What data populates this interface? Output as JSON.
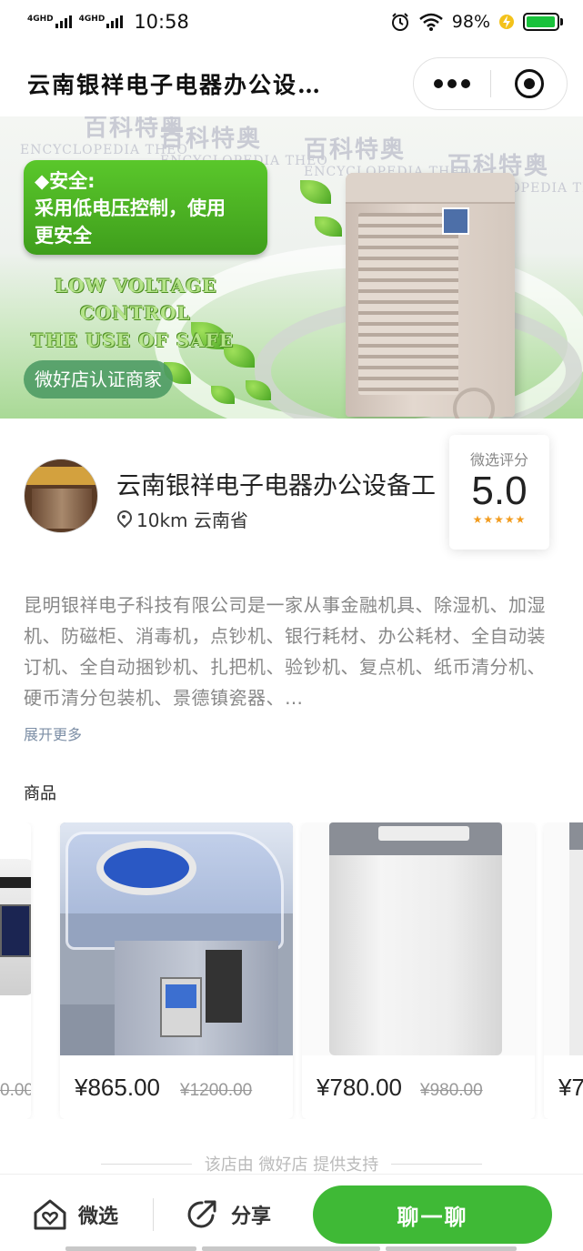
{
  "status_bar": {
    "network1": "4GHD",
    "network2": "4GHD",
    "time": "10:58",
    "battery": "98%"
  },
  "title_bar": {
    "title": "云南银祥电子电器办公设…"
  },
  "banner": {
    "watermark_cn": "百科特奥",
    "watermark_en": "ENCYCLOPEDIA THEO",
    "feature_title": "◆安全:",
    "feature_text1": "采用低电压控制，使用",
    "feature_text2": "更安全",
    "en_line1": "LOW VOLTAGE",
    "en_line2": "CONTROL",
    "en_line3": "THE USE OF SAFE",
    "verified_label": "微好店认证商家"
  },
  "shop": {
    "name": "云南银祥电子电器办公设备工",
    "distance_location": "10km 云南省",
    "score_label": "微选评分",
    "score_value": "5.0",
    "stars": "★★★★★",
    "description": "昆明银祥电子科技有限公司是一家从事金融机具、除湿机、加湿机、防磁柜、消毒机，点钞机、银行耗材、办公耗材、全自动装订机、全自动捆钞机、扎把机、验钞机、复点机、纸币清分机、硬币清分包装机、景德镇瓷器、…",
    "expand_label": "展开更多"
  },
  "products": {
    "section_title": "商品",
    "items": [
      {
        "price": "¥",
        "old_price": "0.00"
      },
      {
        "price": "¥865.00",
        "old_price": "¥1200.00"
      },
      {
        "price": "¥780.00",
        "old_price": "¥980.00"
      },
      {
        "price": "¥7"
      }
    ]
  },
  "footer": {
    "support_text": "该店由 微好店 提供支持"
  },
  "bottom_bar": {
    "favorite_label": "微选",
    "share_label": "分享",
    "chat_label": "聊一聊"
  },
  "colors": {
    "brand_green": "#3fb936",
    "star": "#f29c1f"
  }
}
